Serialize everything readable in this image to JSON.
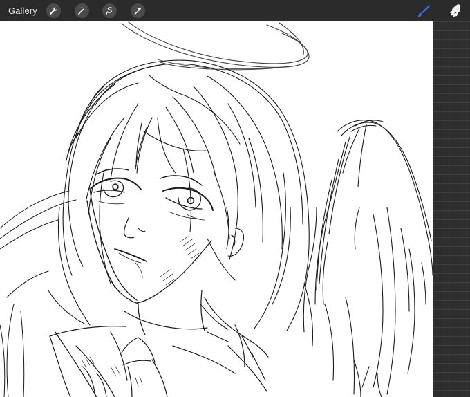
{
  "toolbar": {
    "gallery_label": "Gallery",
    "left_tools": [
      {
        "name": "wrench-icon"
      },
      {
        "name": "magic-wand-icon"
      },
      {
        "name": "selection-icon"
      },
      {
        "name": "transform-arrow-icon"
      }
    ],
    "right_tools": [
      {
        "name": "brush-icon",
        "active": true
      },
      {
        "name": "smudge-icon",
        "active": false
      }
    ],
    "accent": "#3b6df0"
  },
  "colors": {
    "toolbar_bg": "#2b2b2b",
    "sidebar_bg": "#2e2e2e",
    "canvas_bg": "#ffffff",
    "sketch_line": "#1a1a1a"
  }
}
